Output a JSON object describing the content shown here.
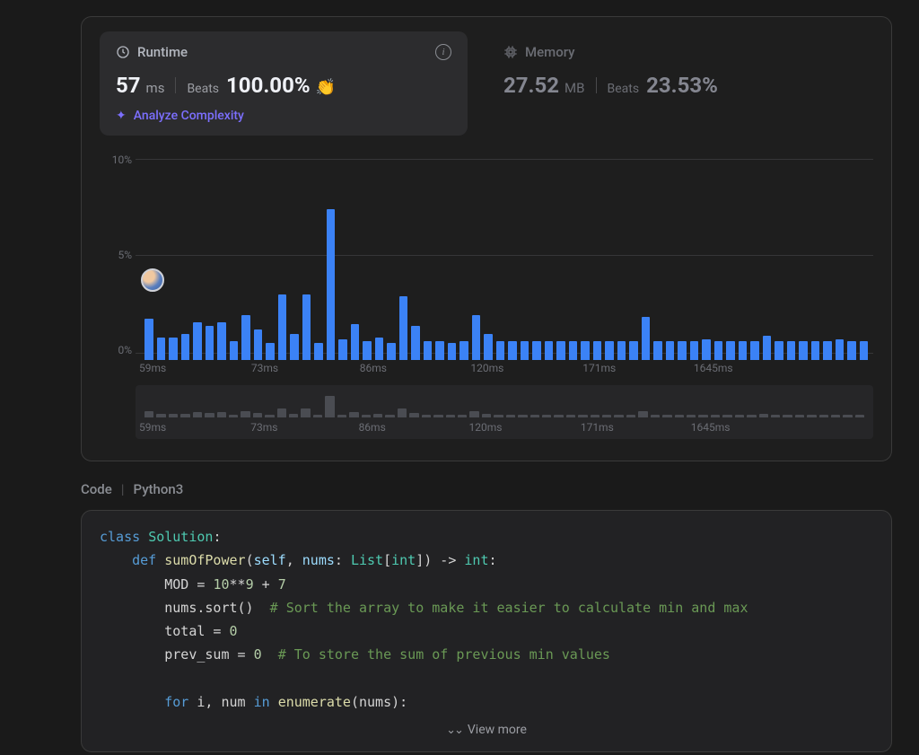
{
  "runtime": {
    "title": "Runtime",
    "value": "57",
    "unit": "ms",
    "beats_label": "Beats",
    "beats_value": "100.00%",
    "clap_icon": "👏",
    "analyze_label": "Analyze Complexity"
  },
  "memory": {
    "title": "Memory",
    "value": "27.52",
    "unit": "MB",
    "beats_label": "Beats",
    "beats_value": "23.53%"
  },
  "chart_data": {
    "type": "bar",
    "ylabel": "",
    "ylim": [
      0,
      10
    ],
    "y_ticks": [
      "10%",
      "5%",
      "0%"
    ],
    "x_ticks": [
      "59ms",
      "73ms",
      "86ms",
      "120ms",
      "171ms",
      "1645ms"
    ],
    "x_tick_positions_pct": [
      0,
      15.5,
      30.5,
      46,
      61.5,
      77
    ],
    "values": [
      2.2,
      1.2,
      1.2,
      1.4,
      2,
      1.8,
      2,
      1.0,
      2.4,
      1.6,
      0.9,
      3.5,
      1.4,
      3.5,
      0.9,
      8.0,
      1.1,
      1.9,
      1.0,
      1.2,
      0.9,
      3.4,
      1.8,
      1.0,
      1.0,
      0.9,
      1.0,
      2.4,
      1.4,
      1.0,
      1.0,
      1.0,
      1.0,
      1.0,
      1.0,
      1.0,
      1.0,
      1.0,
      1.0,
      1.0,
      1.0,
      2.3,
      1.0,
      1.0,
      1.0,
      1.0,
      1.1,
      1.0,
      1.0,
      1.0,
      1.0,
      1.3,
      1.0,
      1.0,
      1.0,
      1.0,
      1.0,
      1.1,
      1.0,
      1.0
    ],
    "user_marker_index": 0
  },
  "minimap": {
    "x_ticks": [
      "59ms",
      "73ms",
      "86ms",
      "120ms",
      "171ms",
      "1645ms"
    ],
    "x_tick_positions_pct": [
      0,
      15.5,
      30.5,
      46,
      61.5,
      77
    ],
    "values": [
      2.2,
      1.2,
      1.2,
      1.4,
      2,
      1.8,
      2,
      1.0,
      2.4,
      1.6,
      0.9,
      3.5,
      1.4,
      3.5,
      0.9,
      8.0,
      1.1,
      1.9,
      1.0,
      1.2,
      0.9,
      3.4,
      1.8,
      1.0,
      1.0,
      0.9,
      1.0,
      2.4,
      1.4,
      1.0,
      1.0,
      1.0,
      1.0,
      1.0,
      1.0,
      1.0,
      1.0,
      1.0,
      1.0,
      1.0,
      1.0,
      2.3,
      1.0,
      1.0,
      1.0,
      1.0,
      1.1,
      1.0,
      1.0,
      1.0,
      1.0,
      1.3,
      1.0,
      1.0,
      1.0,
      1.0,
      1.0,
      1.1,
      1.0,
      1.0
    ]
  },
  "code": {
    "header_label": "Code",
    "language": "Python3",
    "view_more": "View more",
    "tokens": [
      [
        {
          "t": "class ",
          "c": "kw"
        },
        {
          "t": "Solution",
          "c": "cls"
        },
        {
          "t": ":",
          "c": "op"
        }
      ],
      [
        {
          "t": "    ",
          "c": ""
        },
        {
          "t": "def ",
          "c": "kw"
        },
        {
          "t": "sumOfPower",
          "c": "fn"
        },
        {
          "t": "(",
          "c": "op"
        },
        {
          "t": "self",
          "c": "param"
        },
        {
          "t": ", ",
          "c": "op"
        },
        {
          "t": "nums",
          "c": "param"
        },
        {
          "t": ": ",
          "c": "op"
        },
        {
          "t": "List",
          "c": "type"
        },
        {
          "t": "[",
          "c": "op"
        },
        {
          "t": "int",
          "c": "type"
        },
        {
          "t": "]) -> ",
          "c": "op"
        },
        {
          "t": "int",
          "c": "type"
        },
        {
          "t": ":",
          "c": "op"
        }
      ],
      [
        {
          "t": "        MOD = ",
          "c": "py-var"
        },
        {
          "t": "10",
          "c": "num"
        },
        {
          "t": "**",
          "c": "op"
        },
        {
          "t": "9",
          "c": "num"
        },
        {
          "t": " + ",
          "c": "op"
        },
        {
          "t": "7",
          "c": "num"
        }
      ],
      [
        {
          "t": "        nums.sort()  ",
          "c": "py-var"
        },
        {
          "t": "# Sort the array to make it easier to calculate min and max",
          "c": "str-comment"
        }
      ],
      [
        {
          "t": "        total = ",
          "c": "py-var"
        },
        {
          "t": "0",
          "c": "num"
        }
      ],
      [
        {
          "t": "        prev_sum = ",
          "c": "py-var"
        },
        {
          "t": "0",
          "c": "num"
        },
        {
          "t": "  ",
          "c": ""
        },
        {
          "t": "# To store the sum of previous min values",
          "c": "str-comment"
        }
      ],
      [],
      [
        {
          "t": "        ",
          "c": ""
        },
        {
          "t": "for ",
          "c": "kw"
        },
        {
          "t": "i, num ",
          "c": "py-var"
        },
        {
          "t": "in ",
          "c": "kw"
        },
        {
          "t": "enumerate",
          "c": "fn"
        },
        {
          "t": "(nums):",
          "c": "op"
        }
      ]
    ]
  }
}
